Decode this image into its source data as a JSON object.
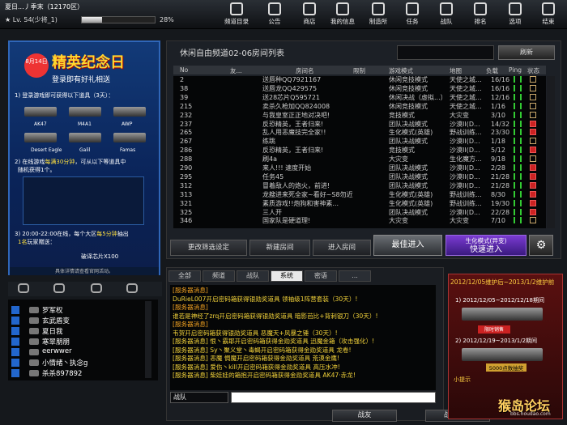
{
  "player": {
    "name": "夏日...丿季末（12170区）",
    "level": "Lv. 54(少将_1)",
    "xp_percent": "28%",
    "xp_fraction": 0.28
  },
  "nav": [
    {
      "label": "频道目录",
      "icon": "channel-icon"
    },
    {
      "label": "公告",
      "icon": "announcement-icon"
    },
    {
      "label": "商店",
      "icon": "shop-icon"
    },
    {
      "label": "我的信息",
      "icon": "profile-icon"
    },
    {
      "label": "制造所",
      "icon": "factory-icon"
    },
    {
      "label": "任务",
      "icon": "mission-icon"
    },
    {
      "label": "战队",
      "icon": "clan-icon"
    },
    {
      "label": "排名",
      "icon": "trophy-icon"
    },
    {
      "label": "选项",
      "icon": "gear-icon"
    },
    {
      "label": "结束",
      "icon": "power-icon"
    }
  ],
  "promo": {
    "date": "8月14日",
    "title": "精英纪念日",
    "subtitle": "登录即有好礼相送",
    "step1": "1) 登录游戏即可获得以下道具（3天）：",
    "guns1": [
      "AK47",
      "M4A1",
      "AWP"
    ],
    "guns2": [
      "Desert Eagle",
      "Galil",
      "Famas"
    ],
    "step2a": "2) 在线游戏",
    "step2b": "每满30分钟",
    "step2c": "，可从以下等道具中",
    "step2d": "随机获得1个。",
    "step3a": "3) 20:00-22:00在线，每个大区",
    "step3b": "每5分钟",
    "step3c": "抽出",
    "step3d": "1名",
    "step3e": "玩家赠送：",
    "prize": "破译芯片X100",
    "footer": "具体详情请查看官网活动。"
  },
  "friends": [
    {
      "name": "罗军权"
    },
    {
      "name": "玄武盾变"
    },
    {
      "name": "夏日我"
    },
    {
      "name": "寒翠朋朋"
    },
    {
      "name": "eerwwer"
    },
    {
      "name": "小情绪丶执念g"
    },
    {
      "name": "杀杀897892"
    }
  ],
  "room_panel": {
    "title": "休闲自由频道02-06房间列表",
    "refresh": "刷新",
    "headers": [
      "No",
      "友...",
      "房间名",
      "限制",
      "游戏模式",
      "地图",
      "负载",
      "Ping",
      "状态"
    ]
  },
  "rooms": [
    {
      "no": "2",
      "name": "送唇种QQ7921167",
      "mode": "休闲竞技模式",
      "map": "天使之城...",
      "load": "16/16",
      "status": "lock"
    },
    {
      "no": "38",
      "name": "送唇龙QQ429575",
      "mode": "休闲竞技模式",
      "map": "天使之城...",
      "load": "16/16",
      "status": "lock"
    },
    {
      "no": "39",
      "name": "送28芯片Q595721",
      "mode": "休闲决战（虚拟...）",
      "map": "天使之城...",
      "load": "12/16",
      "status": "lock"
    },
    {
      "no": "215",
      "name": "卖杀久枪加QQ824008",
      "mode": "休闲竞技模式",
      "map": "天使之城...",
      "load": "1/16",
      "status": "lock"
    },
    {
      "no": "232",
      "name": "与我皇室正正地对决吧!",
      "mode": "竞技模式",
      "map": "大灾变",
      "load": "3/10",
      "status": "lock"
    },
    {
      "no": "237",
      "name": "反恐精英，王者归来!",
      "mode": "团队决战模式",
      "map": "沙漠II(D...",
      "load": "14/32",
      "status": "red"
    },
    {
      "no": "265",
      "name": "乱人用恶魔技完全家!!",
      "mode": "生化模式(英雄)",
      "map": "野战训练...",
      "load": "23/30",
      "status": "red"
    },
    {
      "no": "267",
      "name": "练跳",
      "mode": "团队决战模式",
      "map": "沙漠II(D...",
      "load": "1/18",
      "status": "lock"
    },
    {
      "no": "286",
      "name": "反恐精英，王者归来!",
      "mode": "竞技模式",
      "map": "沙漠II(D...",
      "load": "5/12",
      "status": "red"
    },
    {
      "no": "288",
      "name": "刷4a",
      "mode": "大灾变",
      "map": "生化魔方...",
      "load": "9/18",
      "status": "lock"
    },
    {
      "no": "290",
      "name": "来人!!! 速度开始",
      "mode": "团队决战模式",
      "map": "沙漠II(D...",
      "load": "2/28",
      "status": "red"
    },
    {
      "no": "295",
      "name": "任务45",
      "mode": "团队决战模式",
      "map": "沙漠II(D...",
      "load": "21/28",
      "status": "red"
    },
    {
      "no": "312",
      "name": "冒着敌人的炮火，前进!",
      "mode": "团队决战模式",
      "map": "沙漠II(D...",
      "load": "21/28",
      "status": "red"
    },
    {
      "no": "313",
      "name": "龙艘进来死全家~看好~S8勿近",
      "mode": "生化模式(英雄)",
      "map": "野战训练...",
      "load": "8/30",
      "status": "red"
    },
    {
      "no": "321",
      "name": "素质游戏!!炮狗和害神素...",
      "mode": "生化模式(英雄)",
      "map": "野战训练...",
      "load": "19/30",
      "status": "red"
    },
    {
      "no": "325",
      "name": "三人开",
      "mode": "团队决战模式",
      "map": "沙漠II(D...",
      "load": "22/28",
      "status": "red"
    },
    {
      "no": "346",
      "name": "国家队是硬道理!",
      "mode": "大灾变",
      "map": "大灾变",
      "load": "7/10",
      "status": "lock"
    }
  ],
  "room_buttons": {
    "filter": "更改筛选设定",
    "create": "新建房间",
    "enter": "进入房间",
    "quick": "最佳进入",
    "mode_top": "生化模式(异变)",
    "mode_bottom": "快速进入"
  },
  "chat_tabs": [
    "全部",
    "频道",
    "战队",
    "系统",
    "密语",
    "..."
  ],
  "chat_lines": [
    {
      "kind": "sys",
      "text": "[服务器消息]"
    },
    {
      "kind": "msg",
      "text": "DuRieL007开启密码箱获得银勋奖道具 领袖级1阵营套装（30天）!"
    },
    {
      "kind": "sys",
      "text": "[服务器消息]"
    },
    {
      "kind": "msg",
      "text": "谁若是神经了zrq开启密码箱获得银勋奖道具 暗影芭比+背刺银刀（30天）!"
    },
    {
      "kind": "sys",
      "text": "[服务器消息]"
    },
    {
      "kind": "msg",
      "text": "韦贺开启密码箱获得银勋奖道具 恶魔天+风暴之锤（30天）!"
    },
    {
      "kind": "msg",
      "text": "[服务器消息] 恨丶霸耶开启密码箱获得金勋奖道具 迅魔金箱（攻击强化）!"
    },
    {
      "kind": "msg",
      "text": "[服务器消息] Sy丶聚义堂丶毒蝎开启密码箱获得金勋奖道具 龙卷!"
    },
    {
      "kind": "msg",
      "text": "[服务器消息] 恶魔 惆魔开启密码箱获得金勋奖道具 荒漠金鹰!"
    },
    {
      "kind": "msg",
      "text": "[服务器消息] 爱伤丶kill开启密码箱获得金勋奖道具 高压水冲!"
    },
    {
      "kind": "msg",
      "text": "[服务器消息] 柴娃娃的箱抱开启密码箱获得金勋奖道具 AK47·赤龙!"
    }
  ],
  "chat": {
    "channel_select": "战队"
  },
  "bottom_buttons": {
    "team": "战友",
    "supply": "战场补给"
  },
  "ad": {
    "title": "2012/12/05维护后~2013/1/2维护前",
    "line1": "1) 2012/12/05~2012/12/18期间",
    "tag": "限时销售",
    "line2": "2) 2012/12/19~2013/1/2期间",
    "price": "5000点数抽奖",
    "note": "小提示"
  },
  "watermark": {
    "text": "猴岛论坛",
    "url": "bbs.houdao.com"
  }
}
